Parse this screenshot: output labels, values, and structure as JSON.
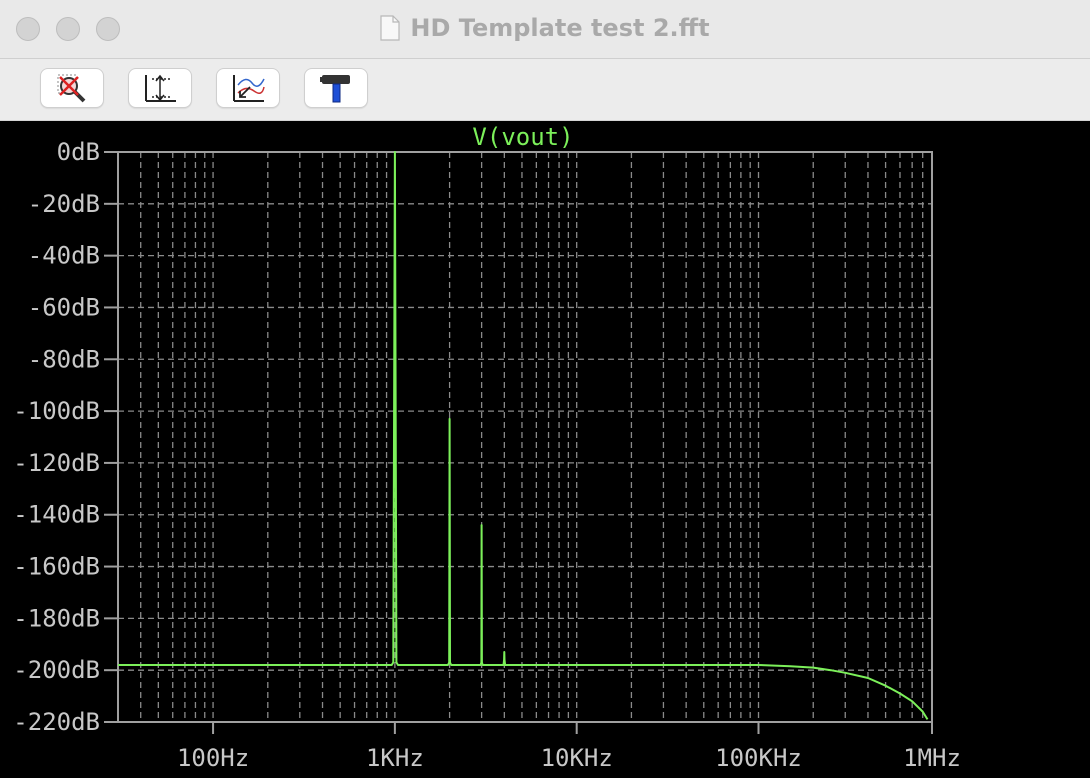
{
  "window": {
    "title": "HD Template test 2.fft"
  },
  "toolbar": {
    "buttons": [
      {
        "name": "zoom-cancel",
        "icon": "magnifier-crossed-icon"
      },
      {
        "name": "autorange",
        "icon": "autorange-axes-icon"
      },
      {
        "name": "zoom-back",
        "icon": "zoom-back-icon"
      },
      {
        "name": "settings",
        "icon": "hammer-icon"
      }
    ]
  },
  "chart_data": {
    "type": "line",
    "title": "V(vout)",
    "xscale": "log",
    "xlim": [
      30,
      900000
    ],
    "ylim": [
      -220,
      0
    ],
    "grid": true,
    "line_color": "#7CF05A",
    "y_ticks": [
      "0dB",
      "-20dB",
      "-40dB",
      "-60dB",
      "-80dB",
      "-100dB",
      "-120dB",
      "-140dB",
      "-160dB",
      "-180dB",
      "-200dB",
      "-220dB"
    ],
    "y_tick_values": [
      0,
      -20,
      -40,
      -60,
      -80,
      -100,
      -120,
      -140,
      -160,
      -180,
      -200,
      -220
    ],
    "x_ticks": [
      "100Hz",
      "1KHz",
      "10KHz",
      "100KHz",
      "1MHz"
    ],
    "x_tick_values": [
      100,
      1000,
      10000,
      100000,
      1000000
    ],
    "series": [
      {
        "x": [
          30,
          100,
          500,
          960,
          980,
          1000,
          1020,
          1040,
          1960,
          1990,
          2000,
          2010,
          2040,
          2960,
          2990,
          3000,
          3010,
          3040,
          3960,
          3990,
          4000,
          4010,
          4040,
          10000,
          50000,
          100000,
          150000,
          200000,
          250000,
          300000,
          400000,
          500000,
          600000,
          700000,
          800000,
          850000
        ],
        "y": [
          -198,
          -198,
          -198,
          -198,
          -197,
          0,
          -197,
          -198,
          -198,
          -197,
          -103,
          -197,
          -198,
          -198,
          -197,
          -144,
          -197,
          -198,
          -198,
          -196,
          -193,
          -196,
          -198,
          -198,
          -198,
          -198,
          -198.5,
          -199,
          -200,
          -201,
          -203,
          -206,
          -209,
          -212,
          -216,
          -219
        ]
      }
    ]
  }
}
